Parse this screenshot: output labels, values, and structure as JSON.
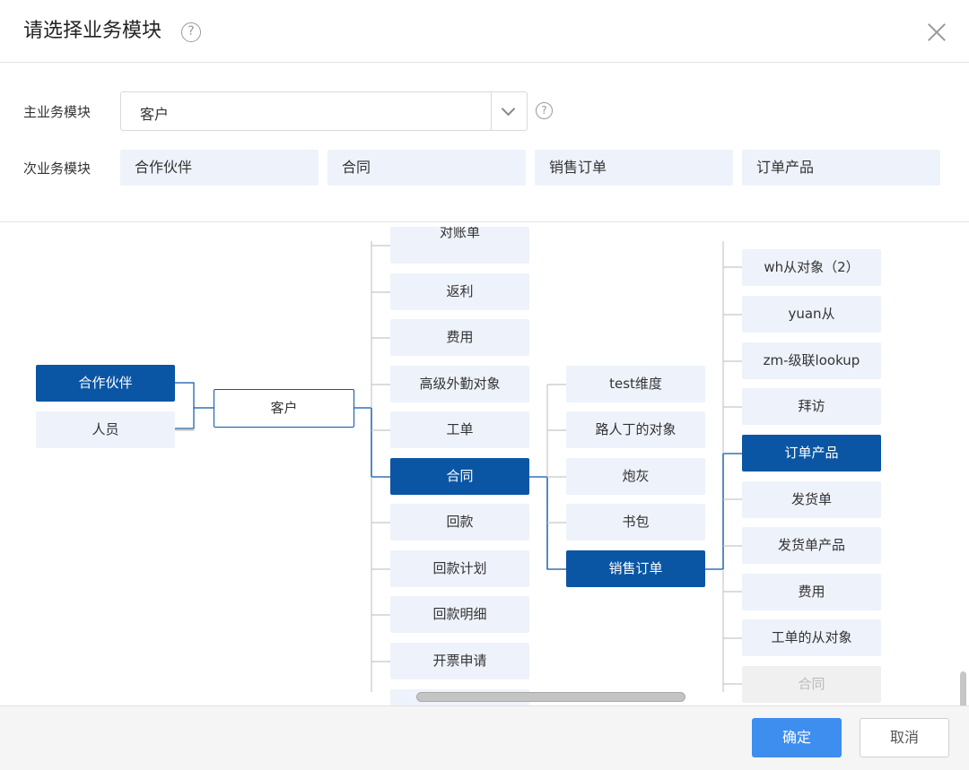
{
  "dialog": {
    "title": "请选择业务模块",
    "help_glyph": "?"
  },
  "form": {
    "main_label": "主业务模块",
    "main_value": "客户",
    "sub_label": "次业务模块",
    "sub_modules": [
      "合作伙伴",
      "合同",
      "销售订单",
      "订单产品"
    ]
  },
  "tree": {
    "col1": [
      {
        "label": "合作伙伴",
        "state": "active"
      },
      {
        "label": "人员",
        "state": "normal"
      }
    ],
    "root": {
      "label": "客户",
      "state": "outline"
    },
    "col3": [
      {
        "label": "对账单",
        "state": "normal"
      },
      {
        "label": "返利",
        "state": "normal"
      },
      {
        "label": "费用",
        "state": "normal"
      },
      {
        "label": "高级外勤对象",
        "state": "normal"
      },
      {
        "label": "工单",
        "state": "normal"
      },
      {
        "label": "合同",
        "state": "active"
      },
      {
        "label": "回款",
        "state": "normal"
      },
      {
        "label": "回款计划",
        "state": "normal"
      },
      {
        "label": "回款明细",
        "state": "normal"
      },
      {
        "label": "开票申请",
        "state": "normal"
      }
    ],
    "col4": [
      {
        "label": "test维度",
        "state": "normal"
      },
      {
        "label": "路人丁的对象",
        "state": "normal"
      },
      {
        "label": "炮灰",
        "state": "normal"
      },
      {
        "label": "书包",
        "state": "normal"
      },
      {
        "label": "销售订单",
        "state": "active"
      }
    ],
    "col5": [
      {
        "label": "wh从对象（2）",
        "state": "normal"
      },
      {
        "label": "yuan从",
        "state": "normal"
      },
      {
        "label": "zm-级联lookup",
        "state": "normal"
      },
      {
        "label": "拜访",
        "state": "normal"
      },
      {
        "label": "订单产品",
        "state": "active"
      },
      {
        "label": "发货单",
        "state": "normal"
      },
      {
        "label": "发货单产品",
        "state": "normal"
      },
      {
        "label": "费用",
        "state": "normal"
      },
      {
        "label": "工单的从对象",
        "state": "normal"
      },
      {
        "label": "合同",
        "state": "disabled"
      }
    ]
  },
  "footer": {
    "ok_label": "确定",
    "cancel_label": "取消"
  },
  "colors": {
    "accent": "#0b56a4",
    "primary_button": "#3d8eef",
    "chip_bg": "#eef2fb"
  }
}
